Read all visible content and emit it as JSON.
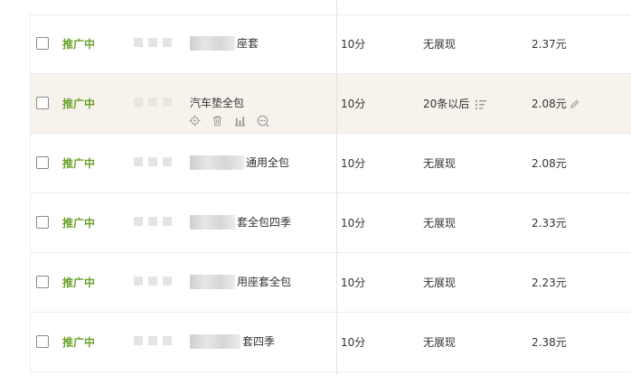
{
  "rows": [
    {
      "status": "推广中",
      "name_blur_w": 50,
      "name": "座套",
      "score": "10分",
      "position": "无展现",
      "bid": "2.37元",
      "highlighted": false
    },
    {
      "status": "推广中",
      "name_blur_w": 0,
      "name": "汽车垫全包",
      "score": "10分",
      "position": "20条以后",
      "bid": "2.08元",
      "highlighted": true
    },
    {
      "status": "推广中",
      "name_blur_w": 60,
      "name": "通用全包",
      "score": "10分",
      "position": "无展现",
      "bid": "2.08元",
      "highlighted": false
    },
    {
      "status": "推广中",
      "name_blur_w": 50,
      "name": "套全包四季",
      "score": "10分",
      "position": "无展现",
      "bid": "2.33元",
      "highlighted": false
    },
    {
      "status": "推广中",
      "name_blur_w": 50,
      "name": "用座套全包",
      "score": "10分",
      "position": "无展现",
      "bid": "2.23元",
      "highlighted": false
    },
    {
      "status": "推广中",
      "name_blur_w": 56,
      "name": "套四季",
      "score": "10分",
      "position": "无展现",
      "bid": "2.38元",
      "highlighted": false
    }
  ],
  "row_actions": [
    "target-icon",
    "trash-icon",
    "bar-chart-icon",
    "more-icon"
  ],
  "colors": {
    "status": "#6aa12a",
    "highlight": "#f8f2ec"
  }
}
